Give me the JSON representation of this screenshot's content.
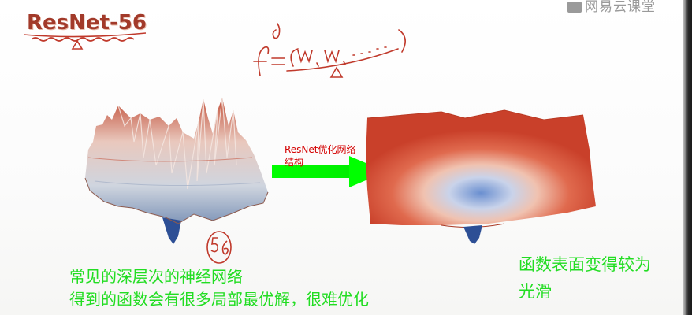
{
  "header": {
    "title": "ResNet-56",
    "watermark": "网易云课堂",
    "watermark_icon": "video-icon"
  },
  "handwriting": {
    "formula_text": "f = (w₁, w₂, .....)",
    "superscript": "d",
    "delta_mark": "Δ",
    "circled_number": "56"
  },
  "arrow": {
    "label_line1": "ResNet优化网络",
    "label_line2": "结构",
    "color": "#00ff00",
    "label_color": "#d40000"
  },
  "captions": {
    "left_line1": "常见的深层次的神经网络",
    "left_line2": "得到的函数会有很多局部最优解，很难优化",
    "right_line1": "函数表面变得较为",
    "right_line2": "光滑",
    "color": "#22dd22"
  },
  "colors": {
    "title": "#a23a2a",
    "surface_red": "#d8452e",
    "surface_blue": "#3b64a8",
    "ink": "#c0392b"
  }
}
